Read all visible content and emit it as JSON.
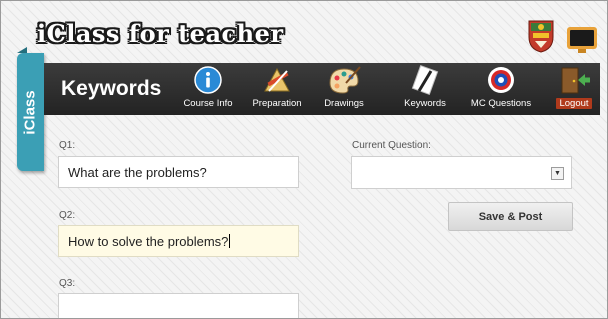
{
  "header": {
    "logo_text": "iClass for teacher",
    "crest_icon": "university-crest-icon",
    "monitor_icon": "monitor-icon"
  },
  "side_tab": {
    "label": "iClass",
    "color": "#3b9fb5"
  },
  "toolbar": {
    "title": "Keywords",
    "background": "#2c2c2c",
    "items": [
      {
        "label": "Course Info",
        "icon": "info-icon"
      },
      {
        "label": "Preparation",
        "icon": "drafting-tools-icon"
      },
      {
        "label": "Drawings",
        "icon": "paint-palette-icon"
      },
      {
        "label": "Keywords",
        "icon": "pencil-note-icon"
      },
      {
        "label": "MC Questions",
        "icon": "target-icon"
      },
      {
        "label": "Logout",
        "icon": "exit-door-icon"
      }
    ]
  },
  "form": {
    "q1": {
      "label": "Q1:",
      "value": "What are the problems?"
    },
    "q2": {
      "label": "Q2:",
      "value": "How to solve the problems?"
    },
    "q3": {
      "label": "Q3:",
      "value": ""
    },
    "current_question": {
      "label": "Current Question:",
      "value": ""
    },
    "save_button": "Save & Post"
  }
}
